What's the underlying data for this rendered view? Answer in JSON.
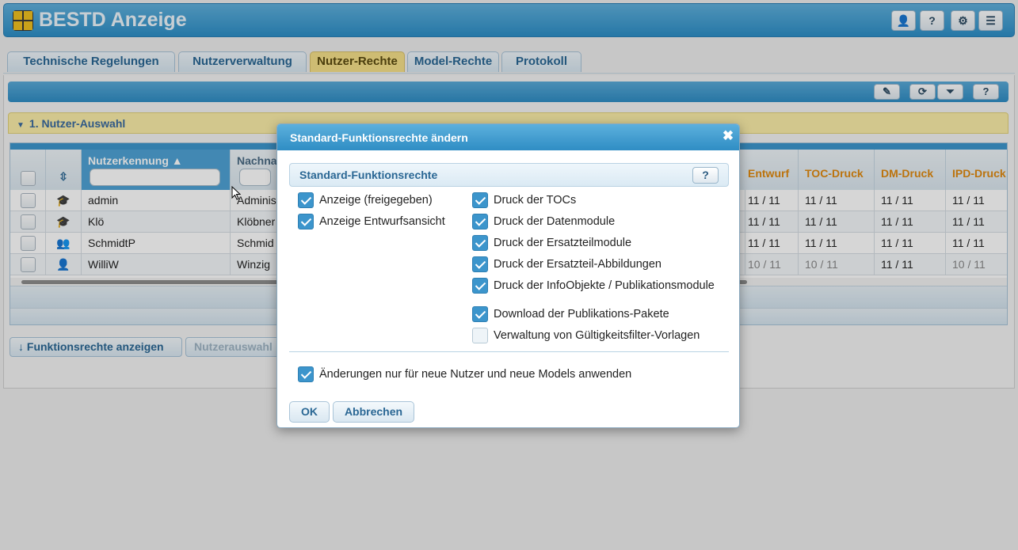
{
  "app": {
    "title": "BESTD Anzeige"
  },
  "topbar_buttons": [
    {
      "icon": "user-icon",
      "glyph": "👤"
    },
    {
      "icon": "help-icon",
      "glyph": "?"
    },
    {
      "icon": "gear-icon",
      "glyph": "⚙"
    },
    {
      "icon": "menu-icon",
      "glyph": "☰"
    }
  ],
  "tabs": [
    {
      "label": "Technische Regelungen",
      "active": false
    },
    {
      "label": "Nutzerverwaltung",
      "active": false
    },
    {
      "label": "Nutzer-Rechte",
      "active": true
    },
    {
      "label": "Model-Rechte",
      "active": false
    },
    {
      "label": "Protokoll",
      "active": false
    }
  ],
  "toolbar_buttons": [
    {
      "icon": "edit-icon",
      "glyph": "✎"
    },
    {
      "icon": "refresh-icon",
      "glyph": "⟳"
    },
    {
      "icon": "filter-clear-icon",
      "glyph": "⏷"
    },
    {
      "icon": "help-icon",
      "glyph": "?"
    }
  ],
  "section": {
    "title": "1. Nutzer-Auswahl"
  },
  "grid": {
    "headers": {
      "sort_icon": "⇳",
      "kennung": "Nutzerkennung ▲",
      "nachname": "Nachna",
      "entwurf": "Entwurf",
      "toc": "TOC-Druck",
      "dm": "DM-Druck",
      "ipd": "IPD-Druck"
    },
    "rows": [
      {
        "type_icon": "graduate-icon",
        "glyph": "🎓",
        "kennung": "admin",
        "nachname": "Adminis",
        "entwurf": "11 / 11",
        "toc": "11 / 11",
        "dm": "11 / 11",
        "ipd": "11 / 11",
        "dim_entwurf": false,
        "dim_toc": false,
        "dim_ipd": false
      },
      {
        "type_icon": "graduate-icon",
        "glyph": "🎓",
        "kennung": "Klö",
        "nachname": "Klöbner",
        "entwurf": "11 / 11",
        "toc": "11 / 11",
        "dm": "11 / 11",
        "ipd": "11 / 11",
        "dim_entwurf": false,
        "dim_toc": false,
        "dim_ipd": false
      },
      {
        "type_icon": "group-icon",
        "glyph": "👥",
        "kennung": "SchmidtP",
        "nachname": "Schmid",
        "entwurf": "11 / 11",
        "toc": "11 / 11",
        "dm": "11 / 11",
        "ipd": "11 / 11",
        "dim_entwurf": false,
        "dim_toc": false,
        "dim_ipd": false
      },
      {
        "type_icon": "user-icon",
        "glyph": "👤",
        "kennung": "WilliW",
        "nachname": "Winzig",
        "entwurf": "10 / 11",
        "toc": "10 / 11",
        "dm": "11 / 11",
        "ipd": "10 / 11",
        "dim_entwurf": true,
        "dim_toc": true,
        "dim_ipd": true
      }
    ]
  },
  "actions": {
    "show_rights": "↓  Funktionsrechte anzeigen",
    "user_selection": "Nutzerauswahl"
  },
  "dialog": {
    "title": "Standard-Funktionsrechte ändern",
    "close_glyph": "✖",
    "fieldset_title": "Standard-Funktionsrechte",
    "help_glyph": "?",
    "left_options": [
      {
        "label": "Anzeige (freigegeben)",
        "checked": true
      },
      {
        "label": "Anzeige Entwurfsansicht",
        "checked": true
      }
    ],
    "right_options": [
      {
        "label": "Druck der TOCs",
        "checked": true
      },
      {
        "label": "Druck der Datenmodule",
        "checked": true
      },
      {
        "label": "Druck der Ersatzteilmodule",
        "checked": true
      },
      {
        "label": "Druck der Ersatzteil-Abbildungen",
        "checked": true
      },
      {
        "label": "Druck der InfoObjekte / Publikationsmodule",
        "checked": true
      },
      {
        "label": "Download der Publikations-Pakete",
        "checked": true
      },
      {
        "label": "Verwaltung von Gültigkeitsfilter-Vorlagen",
        "checked": false
      }
    ],
    "apply_new_only": {
      "label": "Änderungen nur für neue Nutzer und neue Models anwenden",
      "checked": true
    },
    "ok": "OK",
    "cancel": "Abbrechen"
  }
}
